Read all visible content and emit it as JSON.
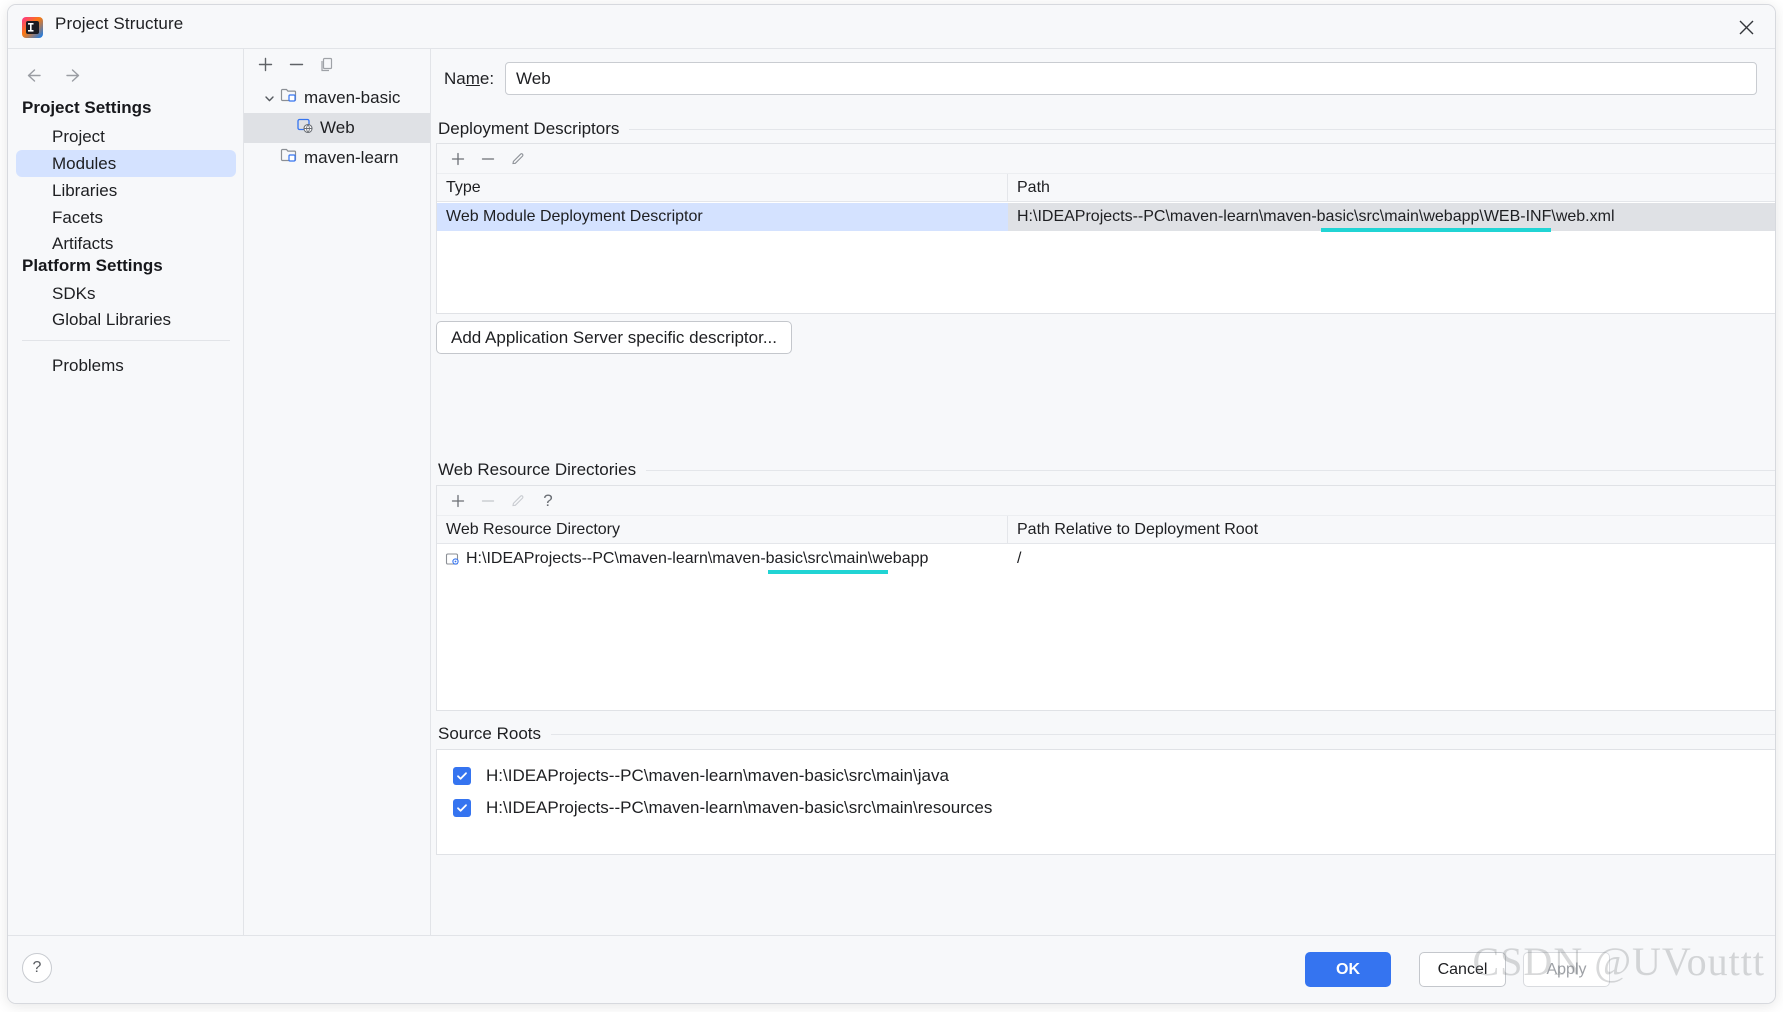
{
  "window": {
    "title": "Project Structure",
    "app_icon": "intellij-idea-icon",
    "close_icon": "close-icon"
  },
  "nav": {
    "back_icon": "arrow-left-icon",
    "forward_icon": "arrow-right-icon"
  },
  "sidebar": {
    "groups": [
      {
        "heading": "Project Settings",
        "items": [
          {
            "label": "Project",
            "selected": false
          },
          {
            "label": "Modules",
            "selected": true
          },
          {
            "label": "Libraries",
            "selected": false
          },
          {
            "label": "Facets",
            "selected": false
          },
          {
            "label": "Artifacts",
            "selected": false
          }
        ]
      },
      {
        "heading": "Platform Settings",
        "items": [
          {
            "label": "SDKs",
            "selected": false
          },
          {
            "label": "Global Libraries",
            "selected": false
          }
        ]
      }
    ],
    "problems": {
      "label": "Problems"
    }
  },
  "module_tree": {
    "toolbar": [
      {
        "name": "add-module-button",
        "glyph": "+"
      },
      {
        "name": "remove-module-button",
        "glyph": "−"
      },
      {
        "name": "copy-module-button",
        "glyph": "copy-icon"
      }
    ],
    "nodes": [
      {
        "label": "maven-basic",
        "level": 0,
        "expanded": true,
        "selected": false,
        "icon": "module-folder-icon"
      },
      {
        "label": "Web",
        "level": 1,
        "expanded": null,
        "selected": true,
        "icon": "web-facet-icon"
      },
      {
        "label": "maven-learn",
        "level": 0,
        "expanded": null,
        "selected": false,
        "icon": "module-folder-icon"
      }
    ]
  },
  "main": {
    "name_field": {
      "label_before": "Na",
      "label_mnemonic": "m",
      "label_after": "e:",
      "value": "Web"
    },
    "deployment_descriptors": {
      "title": "Deployment Descriptors",
      "toolbar": [
        {
          "name": "add-descriptor-button",
          "glyph": "+",
          "disabled": false
        },
        {
          "name": "remove-descriptor-button",
          "glyph": "−",
          "disabled": false
        },
        {
          "name": "edit-descriptor-button",
          "glyph": "pencil-icon",
          "disabled": false
        }
      ],
      "columns": [
        "Type",
        "Path"
      ],
      "rows": [
        {
          "type": "Web Module Deployment Descriptor",
          "path": "H:\\IDEAProjects--PC\\maven-learn\\maven-basic\\src\\main\\webapp\\WEB-INF\\web.xml",
          "selected": true
        }
      ],
      "add_server_descriptor_button": "Add Application Server specific descriptor..."
    },
    "web_resource_directories": {
      "title": "Web Resource Directories",
      "toolbar": [
        {
          "name": "add-web-resource-button",
          "glyph": "+",
          "disabled": false
        },
        {
          "name": "remove-web-resource-button",
          "glyph": "−",
          "disabled": true
        },
        {
          "name": "edit-web-resource-button",
          "glyph": "pencil-icon",
          "disabled": true
        },
        {
          "name": "help-web-resource-button",
          "glyph": "?",
          "disabled": false
        }
      ],
      "columns": [
        "Web Resource Directory",
        "Path Relative to Deployment Root"
      ],
      "rows": [
        {
          "directory": "H:\\IDEAProjects--PC\\maven-learn\\maven-basic\\src\\main\\webapp",
          "relative_path": "/",
          "icon": "folder-module-icon"
        }
      ]
    },
    "source_roots": {
      "title": "Source Roots",
      "items": [
        {
          "label": "H:\\IDEAProjects--PC\\maven-learn\\maven-basic\\src\\main\\java",
          "checked": true
        },
        {
          "label": "H:\\IDEAProjects--PC\\maven-learn\\maven-basic\\src\\main\\resources",
          "checked": true
        }
      ]
    }
  },
  "footer": {
    "help_label": "?",
    "ok_label": "OK",
    "cancel_label": "Cancel",
    "apply_label": "Apply"
  },
  "watermark": {
    "text": "CSDN @UVouttt"
  },
  "colors": {
    "accent": "#3574f0",
    "selection_blue": "#d4e2ff",
    "selection_gray": "#dfe1e5",
    "highlight_underline": "#21d4d4",
    "panel_bg": "#f7f8fa"
  }
}
